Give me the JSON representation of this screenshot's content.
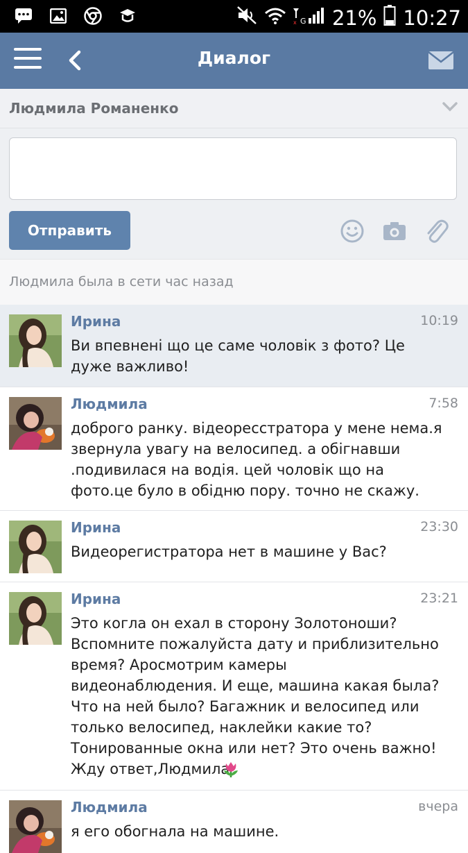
{
  "status_bar": {
    "battery": "21%",
    "time": "10:27",
    "icons": [
      "message-icon",
      "image-icon",
      "chrome-icon",
      "app-icon",
      "mute-icon",
      "wifi-icon",
      "signal-icon",
      "battery-icon"
    ]
  },
  "header": {
    "title": "Диалог",
    "icons": [
      "menu-icon",
      "back-icon",
      "mail-icon"
    ]
  },
  "recipient": {
    "name": "Людмила Романенко"
  },
  "compose": {
    "input_value": "",
    "send_label": "Отправить",
    "icons": [
      "emoji-icon",
      "camera-icon",
      "attach-icon"
    ]
  },
  "online_status": "Людмила была в сети час назад",
  "colors": {
    "header": "#5a7aa3",
    "send_button": "#5f83ad",
    "name": "#5d7ba3",
    "unread_bg": "#e9edf2"
  },
  "messages": [
    {
      "name": "Ирина",
      "time": "10:19",
      "text": "Ви впевнені що це саме чоловік з фото? Це\nдуже важливо!"
    },
    {
      "name": "Людмила",
      "time": "7:58",
      "text": "доброго ранку. відеоресстратора у мене нема.я\nзвернула увагу на велосипед. а обігнавши\n.подивилася на водія. цей чоловік що на\nфото.це було в обідню пору. точно не скажу."
    },
    {
      "name": "Ирина",
      "time": "23:30",
      "text": "Видеорегистратора нет в машине у Вас?"
    },
    {
      "name": "Ирина",
      "time": "23:21",
      "text": "Это когла он ехал в сторону Золотоноши?\nВспомните пожалуйста дату и приблизительно\nвремя? Аросмотрим камеры\nвидеонаблюдения. И еще, машина какая была?\nЧто на ней было? Багажник и велосипед или\nтолько велосипед, наклейки какие то?\nТонированные окна или нет? Это очень важно!\nЖду ответ,Людмила"
    },
    {
      "name": "Людмила",
      "time": "вчера",
      "text": "я его обогнала на машине."
    }
  ]
}
